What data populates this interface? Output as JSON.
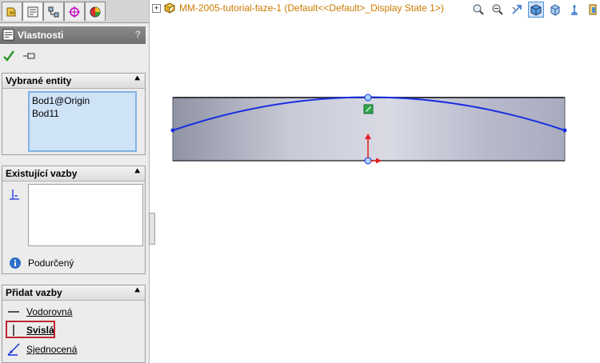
{
  "panel": {
    "title": "Vlastnosti",
    "help": "?",
    "groups": {
      "selected": {
        "title": "Vybrané entity",
        "items": [
          "Bod1@Origin",
          "Bod11"
        ]
      },
      "existing": {
        "title": "Existující vazby",
        "status": "Podurčený"
      },
      "add": {
        "title": "Přidat vazby",
        "items": [
          "Vodorovná",
          "Svislá",
          "Sjednocená"
        ]
      }
    }
  },
  "tree": {
    "title": "MM-2005-tutorial-faze-1  (Default<<Default>_Display State 1>)"
  },
  "colors": {
    "sketch": "#1a2fe0",
    "highlight": "#c0272d",
    "title": "#cc7a00"
  }
}
